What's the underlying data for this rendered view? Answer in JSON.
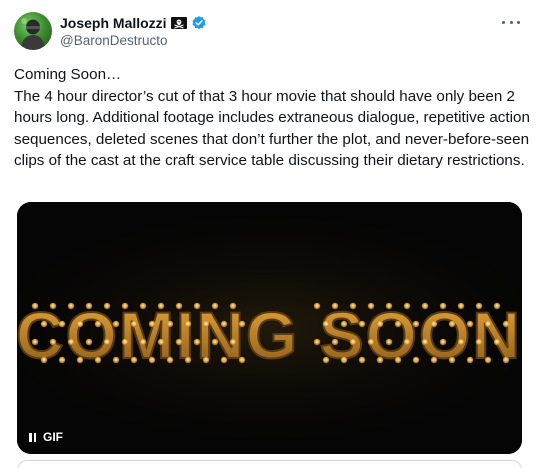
{
  "author": {
    "display_name": "Joseph Mallozzi",
    "handle": "@BaronDestructo",
    "avatar_icon": "avatar-green-figure",
    "badge_icons": [
      "pirate-flag-icon",
      "verified-badge-icon"
    ],
    "verified_color": "#1d9bf0"
  },
  "tweet": {
    "text": "Coming Soon…\nThe 4 hour director’s cut of that 3 hour movie that should have only been 2 hours long.  Additional footage includes extraneous dialogue, repetitive action sequences, deleted scenes that don’t further the plot, and never-before-seen clips of the cast at the craft service table discussing their dietary restrictions."
  },
  "media": {
    "type": "gif",
    "headline": "COMING SOON",
    "badge_label": "GIF",
    "badge_icon": "pause-icon",
    "bulb_color": "#ffd36b",
    "letter_color": "#c98a2a"
  },
  "menu": {
    "icon": "more-options-icon"
  }
}
